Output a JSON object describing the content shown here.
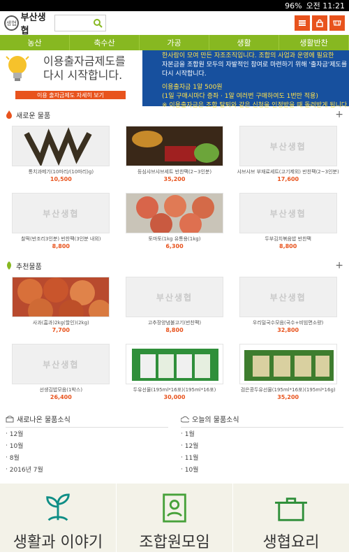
{
  "status_bar": {
    "battery": "96%",
    "time": "오전 11:21"
  },
  "header": {
    "logo_text": "부산생협",
    "logo_mark": "생협"
  },
  "nav": {
    "items": [
      "농산",
      "축수산",
      "가공",
      "생활",
      "생활반찬"
    ]
  },
  "banner": {
    "title_line1": "이용출자금제도를",
    "title_line2": "다시 시작합니다.",
    "button": "이용 출자금제도 자세히 보기",
    "right_line1": "한사람이 모여 만든 자조조직입니다. 조합의 사업과 운영에 필요한",
    "right_line2": "자본금을 조합원 모두의 자발적인 참여로 마련하기 위해 '출자금'제도를",
    "right_line3": "다시 시작합니다.",
    "right_line4": "이용출자금 1알 500원",
    "right_line5": "(1일 구매시마다 증좌 · 1알 여러번 구매하여도 1번만 적용)",
    "right_line6": "※ 이용출자금은 조합 탈퇴와 같은 신청을 인정받을 때 돌려받게 됩니다."
  },
  "new_products": {
    "title": "새로운 물품",
    "items": [
      {
        "name": "통치과메기(10마리/(10마리)g)",
        "price": "10,500"
      },
      {
        "name": "등심샤브샤브세트 반찬팩(2~3인분)",
        "price": "35,200"
      },
      {
        "name": "샤브샤브 부재료세트(고기제외) 반찬팩(2~3인분)",
        "price": "17,600"
      },
      {
        "name": "찰떡(반조리3인분) 반찬팩(3인분 내외)",
        "price": "8,800"
      },
      {
        "name": "토마토(1kg 유통용(1kg)",
        "price": "6,300"
      },
      {
        "name": "두부김치볶음밥 반찬팩",
        "price": "8,800"
      }
    ]
  },
  "recommended": {
    "title": "추천물품",
    "items": [
      {
        "name": "사과(흠과)2kg(할인)(2kg)",
        "price": "7,700"
      },
      {
        "name": "고추장양념불고기(반찬팩)",
        "price": "8,800"
      },
      {
        "name": "우리밀국수모음(국수+비빔면소량)",
        "price": "32,800"
      },
      {
        "name": "선생김밥모음(1박스)",
        "price": "26,400"
      },
      {
        "name": "두유선물(195ml*16포)(195ml*16포)",
        "price": "30,000"
      },
      {
        "name": "검은콩두유선물(195ml*16포)(195ml*16g)",
        "price": "35,200"
      }
    ]
  },
  "news_left": {
    "title": "새로나온 물품소식",
    "items": [
      "12월",
      "10월",
      "8월",
      "2016년 7월"
    ]
  },
  "news_right": {
    "title": "오늘의 물품소식",
    "items": [
      "1월",
      "12월",
      "11월",
      "10월"
    ]
  },
  "bottom": {
    "items": [
      "생활과 이야기",
      "조합원모임",
      "생협요리"
    ]
  },
  "colors": {
    "accent": "#e8531d",
    "nav_green": "#87b821",
    "banner_blue": "#17509e",
    "bottom_bg": "#f3f2e8",
    "icon_teal": "#0f8e86"
  }
}
